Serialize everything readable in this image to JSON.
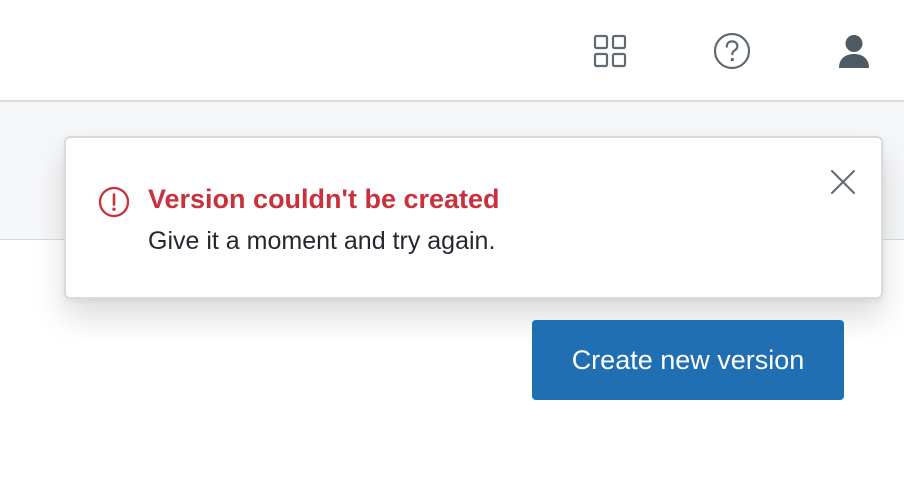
{
  "header": {
    "icons": {
      "apps": "apps-grid-icon",
      "help": "help-circle-icon",
      "user": "user-icon"
    }
  },
  "toast": {
    "title": "Version couldn't be created",
    "message": "Give it a moment and try again.",
    "status_icon": "error-circle-icon",
    "close_icon": "close-icon",
    "title_color": "#c9313b"
  },
  "actions": {
    "create_label": "Create new version",
    "create_color": "#1f6fb2"
  }
}
